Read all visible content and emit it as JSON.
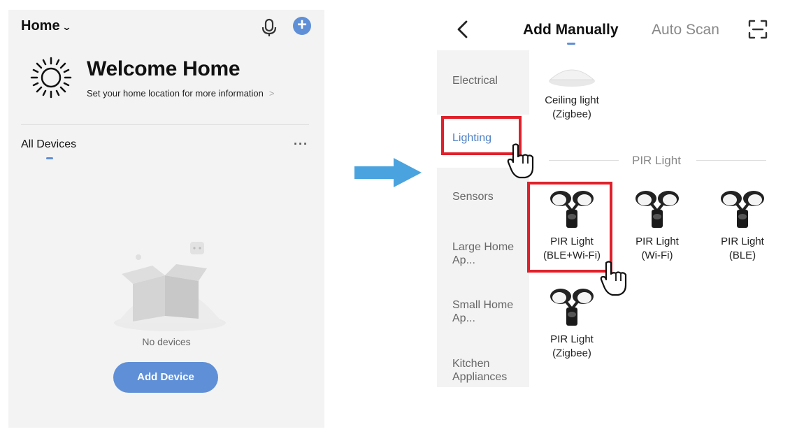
{
  "left": {
    "home_label": "Home",
    "welcome_title": "Welcome Home",
    "welcome_subtitle": "Set your home location for more information",
    "subtitle_arrow": ">",
    "all_devices": "All Devices",
    "more": "···",
    "empty_text": "No devices",
    "add_device_label": "Add Device"
  },
  "right": {
    "tabs": {
      "manual": "Add Manually",
      "scan": "Auto Scan"
    },
    "categories": [
      "Electrical",
      "Lighting",
      "Sensors",
      "Large Home Ap...",
      "Small Home Ap...",
      "Kitchen Appliances"
    ],
    "active_category": "Lighting",
    "section_title": "PIR Light",
    "devices": [
      {
        "line1": "Ceiling light",
        "line2": "(Zigbee)"
      },
      {
        "line1": "PIR Light",
        "line2": "(BLE+Wi-Fi)"
      },
      {
        "line1": "PIR Light",
        "line2": "(Wi-Fi)"
      },
      {
        "line1": "PIR Light",
        "line2": "(BLE)"
      },
      {
        "line1": "PIR Light",
        "line2": "(Zigbee)"
      }
    ]
  },
  "colors": {
    "accent": "#5f8fd6",
    "highlight": "#e0202a",
    "arrow": "#4aa3df"
  },
  "icons": [
    "chevron-down-icon",
    "microphone-icon",
    "plus-icon",
    "sun-icon",
    "more-icon",
    "empty-box-icon",
    "arrow-icon",
    "back-icon",
    "scan-icon",
    "hand-pointer-icon"
  ]
}
